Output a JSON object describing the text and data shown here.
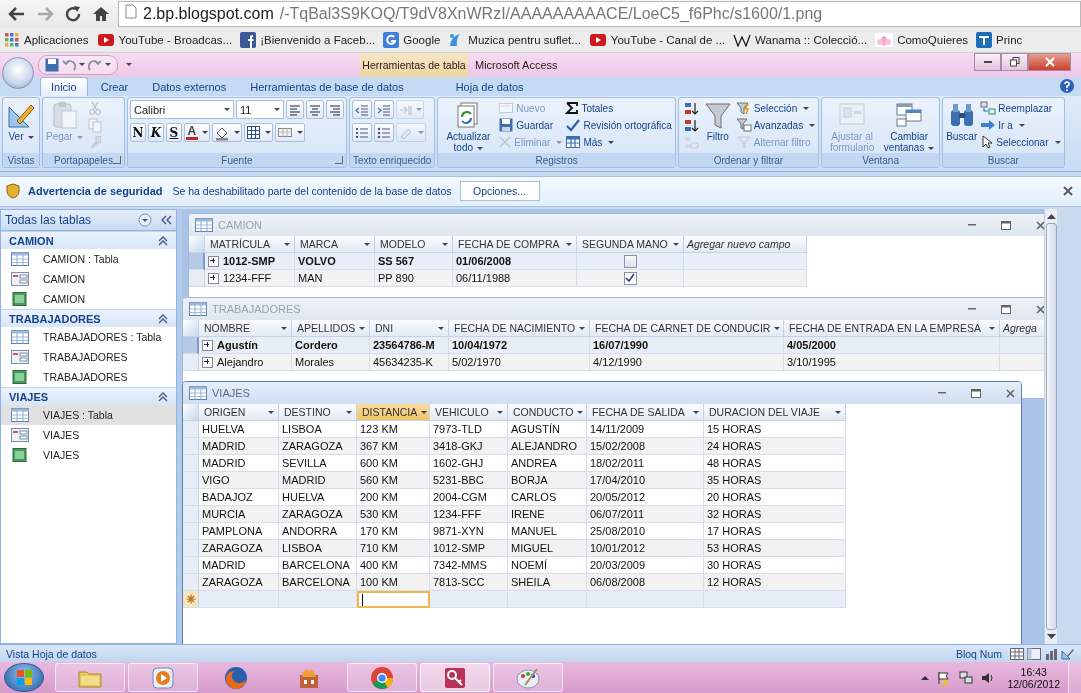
{
  "browser": {
    "url_host": "2.bp.blogspot.com",
    "url_path": "/-TqBal3S9KOQ/T9dV8XnWRzI/AAAAAAAAACE/LoeC5_f6Phc/s1600/1.png",
    "bookmarks": [
      {
        "label": "Aplicaciones",
        "kind": "apps"
      },
      {
        "label": "YouTube - Broadcas...",
        "kind": "youtube"
      },
      {
        "label": "¡Bienvenido a Faceb...",
        "kind": "facebook"
      },
      {
        "label": "Google",
        "kind": "google"
      },
      {
        "label": "Muzica pentru suflet...",
        "kind": "muzica"
      },
      {
        "label": "YouTube - Canal de ...",
        "kind": "youtube"
      },
      {
        "label": "Wanama :: Colecció...",
        "kind": "wiki"
      },
      {
        "label": "ComoQuieres",
        "kind": "lotus"
      },
      {
        "label": "Princ",
        "kind": "et"
      }
    ]
  },
  "access": {
    "contextual_tab": "Herramientas de tabla",
    "title": "Microsoft Access"
  },
  "ribbon": {
    "tabs": [
      {
        "label": "Inicio",
        "selected": true
      },
      {
        "label": "Crear",
        "selected": false
      },
      {
        "label": "Datos externos",
        "selected": false
      },
      {
        "label": "Herramientas de base de datos",
        "selected": false
      },
      {
        "label": "Hoja de datos",
        "selected": false
      }
    ],
    "groups": [
      {
        "label": "Vistas",
        "launcher": false,
        "columns": [
          [
            {
              "kind": "large",
              "label": "Ver",
              "menu": true,
              "disabled": false
            }
          ]
        ]
      },
      {
        "label": "Portapapeles",
        "launcher": true,
        "columns": [
          [
            {
              "kind": "large",
              "label": "Pegar",
              "menu": true,
              "disabled": true
            }
          ],
          [
            {
              "kind": "tool",
              "menu": false,
              "disabled": true
            },
            {
              "kind": "tool",
              "menu": false,
              "disabled": true
            },
            {
              "kind": "tool",
              "menu": false,
              "disabled": true
            }
          ]
        ]
      },
      {
        "label": "Fuente",
        "launcher": true,
        "columns": [
          [
            {
              "kind": "strip",
              "items": [
                {
                  "kind": "combo",
                  "value": "Calibri",
                  "menu": true,
                  "disabled": false
                },
                {
                  "kind": "combo",
                  "value": "11",
                  "menu": true,
                  "disabled": false
                },
                {
                  "kind": "tool",
                  "menu": false,
                  "disabled": false
                },
                {
                  "kind": "tool",
                  "menu": false,
                  "disabled": false
                },
                {
                  "kind": "tool",
                  "menu": false,
                  "disabled": false
                }
              ]
            },
            {
              "kind": "strip",
              "items": [
                {
                  "kind": "glyph",
                  "label": "N",
                  "menu": false,
                  "disabled": false
                },
                {
                  "kind": "glyph",
                  "label": "K",
                  "menu": false,
                  "disabled": false
                },
                {
                  "kind": "glyph",
                  "label": "S",
                  "menu": false,
                  "disabled": false
                },
                {
                  "kind": "glyph",
                  "label": "A",
                  "menu": true,
                  "disabled": false,
                  "color": "#c0282d"
                },
                {
                  "kind": "tool",
                  "menu": true,
                  "disabled": false
                },
                {
                  "kind": "tool",
                  "menu": true,
                  "disabled": false
                },
                {
                  "kind": "tool",
                  "menu": true,
                  "disabled": false
                }
              ]
            }
          ]
        ]
      },
      {
        "label": "Texto enriquecido",
        "launcher": false,
        "columns": [
          [
            {
              "kind": "strip",
              "items": [
                {
                  "kind": "tool",
                  "menu": false,
                  "disabled": false
                },
                {
                  "kind": "tool",
                  "menu": false,
                  "disabled": false
                },
                {
                  "kind": "tool",
                  "menu": true,
                  "disabled": true
                }
              ]
            },
            {
              "kind": "strip",
              "items": [
                {
                  "kind": "tool",
                  "menu": false,
                  "disabled": false
                },
                {
                  "kind": "tool",
                  "menu": false,
                  "disabled": false
                },
                {
                  "kind": "tool",
                  "menu": true,
                  "disabled": true
                }
              ]
            }
          ]
        ]
      },
      {
        "label": "Registros",
        "launcher": false,
        "columns": [
          [
            {
              "kind": "large",
              "label": "Actualizar todo",
              "menu": true,
              "disabled": false
            }
          ],
          [
            {
              "kind": "small",
              "label": "Nuevo",
              "menu": false,
              "disabled": true
            },
            {
              "kind": "small",
              "label": "Guardar",
              "menu": false,
              "disabled": false
            },
            {
              "kind": "small",
              "label": "Eliminar",
              "menu": true,
              "disabled": true
            }
          ],
          [
            {
              "kind": "small",
              "label": "Totales",
              "menu": false,
              "disabled": false
            },
            {
              "kind": "small",
              "label": "Revisión ortográfica",
              "menu": false,
              "disabled": false
            },
            {
              "kind": "small",
              "label": "Más",
              "menu": true,
              "disabled": false
            }
          ]
        ]
      },
      {
        "label": "Ordenar y filtrar",
        "launcher": false,
        "columns": [
          [
            {
              "kind": "tool",
              "menu": false,
              "disabled": false
            },
            {
              "kind": "tool",
              "menu": false,
              "disabled": false
            },
            {
              "kind": "tool",
              "menu": false,
              "disabled": true
            }
          ],
          [
            {
              "kind": "large",
              "label": "Filtro",
              "menu": false,
              "disabled": false
            }
          ],
          [
            {
              "kind": "small",
              "label": "Selección",
              "menu": true,
              "disabled": false
            },
            {
              "kind": "small",
              "label": "Avanzadas",
              "menu": true,
              "disabled": false
            },
            {
              "kind": "small",
              "label": "Alternar filtro",
              "menu": false,
              "disabled": true
            }
          ]
        ]
      },
      {
        "label": "Ventana",
        "launcher": false,
        "columns": [
          [
            {
              "kind": "large",
              "label": "Ajustar al formulario",
              "menu": false,
              "disabled": true
            }
          ],
          [
            {
              "kind": "large",
              "label": "Cambiar ventanas",
              "menu": true,
              "disabled": false
            }
          ]
        ]
      },
      {
        "label": "Buscar",
        "launcher": false,
        "columns": [
          [
            {
              "kind": "large",
              "label": "Buscar",
              "menu": false,
              "disabled": false
            }
          ],
          [
            {
              "kind": "small",
              "label": "Reemplazar",
              "menu": false,
              "disabled": false
            },
            {
              "kind": "small",
              "label": "Ir a",
              "menu": true,
              "disabled": false
            },
            {
              "kind": "small",
              "label": "Seleccionar",
              "menu": true,
              "disabled": false
            }
          ]
        ]
      }
    ]
  },
  "security": {
    "title": "Advertencia de seguridad",
    "message": "Se ha deshabilitado parte del contenido de la base de datos",
    "button": "Opciones..."
  },
  "nav": {
    "title": "Todas las tablas",
    "groups": [
      {
        "label": "CAMION",
        "items": [
          {
            "label": "CAMION : Tabla",
            "kind": "table",
            "selected": false
          },
          {
            "label": "CAMION",
            "kind": "form",
            "selected": false
          },
          {
            "label": "CAMION",
            "kind": "report",
            "selected": false
          }
        ]
      },
      {
        "label": "TRABAJADORES",
        "items": [
          {
            "label": "TRABAJADORES : Tabla",
            "kind": "table",
            "selected": false
          },
          {
            "label": "TRABAJADORES",
            "kind": "form",
            "selected": false
          },
          {
            "label": "TRABAJADORES",
            "kind": "report",
            "selected": false
          }
        ]
      },
      {
        "label": "VIAJES",
        "items": [
          {
            "label": "VIAJES : Tabla",
            "kind": "table",
            "selected": true
          },
          {
            "label": "VIAJES",
            "kind": "form",
            "selected": false
          },
          {
            "label": "VIAJES",
            "kind": "report",
            "selected": false
          }
        ]
      }
    ]
  },
  "windows": [
    {
      "title": "CAMION",
      "active": false,
      "new_record_row": false,
      "columns": [
        {
          "label": "MATRÍCULA",
          "kind": "text",
          "selected": false
        },
        {
          "label": "MARCA",
          "kind": "text",
          "selected": false
        },
        {
          "label": "MODELO",
          "kind": "text",
          "selected": false
        },
        {
          "label": "FECHA DE COMPRA",
          "kind": "text",
          "selected": false
        },
        {
          "label": "SEGUNDA MANO",
          "kind": "check",
          "selected": false
        },
        {
          "label": "Agregar nuevo campo",
          "kind": "add",
          "selected": false
        }
      ],
      "rows": [
        {
          "cells": [
            "1012-SMP",
            "VOLVO",
            "SS 567",
            "01/06/2008"
          ],
          "checked": false,
          "current": true,
          "expandable": true
        },
        {
          "cells": [
            "1234-FFF",
            "MAN",
            "PP 890",
            "06/11/1988"
          ],
          "checked": true,
          "current": false,
          "expandable": true
        }
      ]
    },
    {
      "title": "TRABAJADORES",
      "active": false,
      "new_record_row": false,
      "columns": [
        {
          "label": "NOMBRE",
          "kind": "text",
          "selected": false
        },
        {
          "label": "APELLIDOS",
          "kind": "text",
          "selected": false
        },
        {
          "label": "DNI",
          "kind": "text",
          "selected": false
        },
        {
          "label": "FECHA DE NACIMIENTO",
          "kind": "text",
          "selected": false
        },
        {
          "label": "FECHA DE CARNET DE CONDUCIR",
          "kind": "text",
          "selected": false
        },
        {
          "label": "FECHA DE ENTRADA EN LA EMPRESA",
          "kind": "text",
          "selected": false
        },
        {
          "label": "Agrega",
          "kind": "add",
          "selected": false
        }
      ],
      "rows": [
        {
          "cells": [
            "Agustín",
            "Cordero",
            "23564786-M",
            "10/04/1972",
            "16/07/1990",
            "4/05/2000"
          ],
          "current": true,
          "expandable": true
        },
        {
          "cells": [
            "Alejandro",
            "Morales",
            "45634235-K",
            "5/02/1970",
            "4/12/1990",
            "3/10/1995"
          ],
          "current": false,
          "expandable": true
        }
      ]
    },
    {
      "title": "VIAJES",
      "active": true,
      "new_record_row": true,
      "columns": [
        {
          "label": "ORIGEN",
          "kind": "text",
          "selected": false
        },
        {
          "label": "DESTINO",
          "kind": "text",
          "selected": false
        },
        {
          "label": "DISTANCIA",
          "kind": "text",
          "selected": true
        },
        {
          "label": "VEHICULO",
          "kind": "text",
          "selected": false
        },
        {
          "label": "CONDUCTO",
          "kind": "text",
          "selected": false
        },
        {
          "label": "FECHA DE SALIDA",
          "kind": "text",
          "selected": false
        },
        {
          "label": "DURACION DEL VIAJE",
          "kind": "text",
          "selected": false
        }
      ],
      "rows": [
        {
          "cells": [
            "HUELVA",
            "LISBOA",
            "123 KM",
            "7973-TLD",
            "AGUSTÍN",
            "14/11/2009",
            "15 HORAS"
          ],
          "current": false,
          "expandable": false
        },
        {
          "cells": [
            "MADRID",
            "ZARAGOZA",
            "367 KM",
            "3418-GKJ",
            "ALEJANDRO",
            "15/02/2008",
            "24 HORAS"
          ],
          "current": false,
          "expandable": false
        },
        {
          "cells": [
            "MADRID",
            "SEVILLA",
            "600 KM",
            "1602-GHJ",
            "ANDREA",
            "18/02/2011",
            "48 HORAS"
          ],
          "current": false,
          "expandable": false
        },
        {
          "cells": [
            "VIGO",
            "MADRID",
            "560 KM",
            "5231-BBC",
            "BORJA",
            "17/04/2010",
            "35 HORAS"
          ],
          "current": false,
          "expandable": false
        },
        {
          "cells": [
            "BADAJOZ",
            "HUELVA",
            "200 KM",
            "2004-CGM",
            "CARLOS",
            "20/05/2012",
            "20 HORAS"
          ],
          "current": false,
          "expandable": false
        },
        {
          "cells": [
            "MURCIA",
            "ZARAGOZA",
            "530 KM",
            "1234-FFF",
            "IRENE",
            "06/07/2011",
            "32 HORAS"
          ],
          "current": false,
          "expandable": false
        },
        {
          "cells": [
            "PAMPLONA",
            "ANDORRA",
            "170 KM",
            "9871-XYN",
            "MANUEL",
            "25/08/2010",
            "17 HORAS"
          ],
          "current": false,
          "expandable": false
        },
        {
          "cells": [
            "ZARAGOZA",
            "LISBOA",
            "710 KM",
            "1012-SMP",
            "MIGUEL",
            "10/01/2012",
            "53 HORAS"
          ],
          "current": false,
          "expandable": false
        },
        {
          "cells": [
            "MADRID",
            "BARCELONA",
            "400 KM",
            "7342-MMS",
            "NOEMÍ",
            "20/03/2009",
            "30 HORAS"
          ],
          "current": false,
          "expandable": false
        },
        {
          "cells": [
            "ZARAGOZA",
            "BARCELONA",
            "100 KM",
            "7813-SCC",
            "SHEILA",
            "06/08/2008",
            "12 HORAS"
          ],
          "current": false,
          "expandable": false
        }
      ]
    }
  ],
  "status": {
    "left": "Vista Hoja de datos",
    "right": "Bloq Num"
  },
  "taskbar": {
    "apps": [
      {
        "kind": "folder",
        "running": true,
        "active": false
      },
      {
        "kind": "media",
        "running": true,
        "active": false
      },
      {
        "kind": "firefox",
        "running": false,
        "active": false
      },
      {
        "kind": "game",
        "running": false,
        "active": false
      },
      {
        "kind": "chrome",
        "running": true,
        "active": false
      },
      {
        "kind": "access",
        "running": true,
        "active": true
      },
      {
        "kind": "paint",
        "running": true,
        "active": false
      }
    ],
    "time": "16:43",
    "date": "12/06/2012"
  }
}
